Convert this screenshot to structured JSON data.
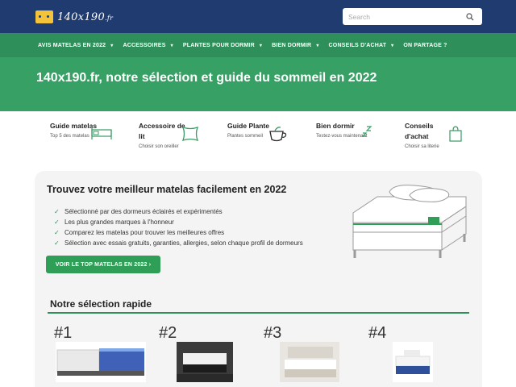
{
  "header": {
    "logo_text": "140x190",
    "logo_tld": ".fr",
    "search_placeholder": "Search"
  },
  "nav": {
    "items": [
      {
        "label": "AVIS MATELAS EN 2022"
      },
      {
        "label": "ACCESSOIRES"
      },
      {
        "label": "PLANTES POUR DORMIR"
      },
      {
        "label": "BIEN DORMIR"
      },
      {
        "label": "CONSEILS D'ACHAT"
      },
      {
        "label": "ON PARTAGE ?"
      }
    ],
    "caret": "▾"
  },
  "hero": {
    "title": "140x190.fr, notre sélection et guide du sommeil en 2022"
  },
  "categories": [
    {
      "title": "Guide matelas",
      "subtitle": "Top 5 des matelas",
      "icon": "bed-icon"
    },
    {
      "title": "Accessoire de lit",
      "subtitle": "Choisir son oreiller",
      "icon": "pillow-icon"
    },
    {
      "title": "Guide Plante",
      "subtitle": "Plantes sommeil",
      "icon": "tea-cup-icon"
    },
    {
      "title": "Bien dormir",
      "subtitle": "Testez-vous maintenant",
      "icon": "sleep-zzz-icon"
    },
    {
      "title": "Conseils d'achat",
      "subtitle": "Choisir sa literie",
      "icon": "shopping-bag-icon"
    }
  ],
  "promo": {
    "title": "Trouvez votre meilleur matelas facilement en 2022",
    "bullets": [
      "Sélectionné par des dormeurs éclairés et expérimentés",
      "Les plus grandes marques à l'honneur",
      "Comparez les matelas pour trouver les meilleures offres",
      "Sélection avec essais gratuits, garanties, allergies, selon chaque profil de dormeurs"
    ],
    "check_symbol": "✓",
    "cta_label": "VOIR LE TOP MATELAS EN 2022  ›"
  },
  "selection": {
    "title": "Notre sélection rapide",
    "picks": [
      {
        "rank": "#1"
      },
      {
        "rank": "#2"
      },
      {
        "rank": "#3"
      },
      {
        "rank": "#4"
      }
    ]
  },
  "colors": {
    "header_bg": "#1f3b6f",
    "nav_bg": "#2f8f5b",
    "hero_bg": "#37a064",
    "accent": "#2f9e57"
  }
}
